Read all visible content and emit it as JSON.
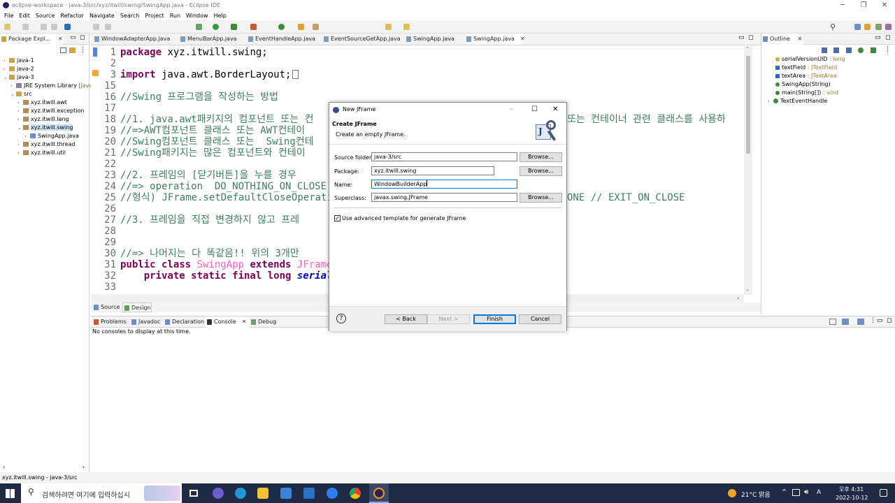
{
  "window": {
    "title": "eclipse-workspace - java-3/src/xyz/itwill/swing/SwingApp.java - Eclipse IDE"
  },
  "menu": [
    "File",
    "Edit",
    "Source",
    "Refactor",
    "Navigate",
    "Search",
    "Project",
    "Run",
    "Window",
    "Help"
  ],
  "package_explorer": {
    "title": "Package Expl...",
    "items": [
      {
        "label": "java-1",
        "level": 0
      },
      {
        "label": "java-2",
        "level": 0
      },
      {
        "label": "java-3",
        "level": 0
      },
      {
        "label": "JRE System Library",
        "suffix": "[JavaS",
        "level": 1
      },
      {
        "label": "src",
        "level": 1
      },
      {
        "label": "xyz.itwill.awt",
        "level": 2
      },
      {
        "label": "xyz.itwill.exception",
        "level": 2
      },
      {
        "label": "xyz.itwill.lang",
        "level": 2
      },
      {
        "label": "xyz.itwill.swing",
        "level": 2,
        "selected": true
      },
      {
        "label": "SwingApp.java",
        "level": 3
      },
      {
        "label": "xyz.itwill.thread",
        "level": 2
      },
      {
        "label": "xyz.itwill.util",
        "level": 2
      }
    ]
  },
  "editor": {
    "tabs": [
      "WindowAdapterApp.java",
      "MenuBarApp.java",
      "EventHandleApp.java",
      "EventSourceGetApp.java",
      "SwingApp.java",
      "SwingApp.java"
    ],
    "line_numbers": [
      "1",
      "2",
      "3",
      "15",
      "16",
      "17",
      "18",
      "19",
      "20",
      "21",
      "22",
      "23",
      "24",
      "25",
      "26",
      "27",
      "28",
      "29",
      "30",
      "31",
      "32",
      "33"
    ],
    "lines": {
      "l1_kw": "package",
      "l1_rest": " xyz.itwill.swing;",
      "l3_kw": "import",
      "l3_rest": " java.awt.BorderLayout;",
      "l16": "//Swing 프로그램을 작성하는 방법",
      "l18a": "//1. java.awt패키지의 컴포넌트 또는 컨",
      "l18b": "또는 컨테이너 관련 클래스를 사용하",
      "l19": "//=>AWT컴포넌트 클래스 또는 AWT컨테이",
      "l20": "//Swing컴포넌트 클래스 또는  Swing컨테",
      "l21": "//Swing패키지는 많은 컴포넌트와 컨테이",
      "l23": "//2. 프레임의 [닫기버튼]을 누를 경우 ",
      "l24": "//=> operation  DO_NOTHING_ON_CLOSE",
      "l25a": "//형식) JFrame.setDefaultCloseOperatio",
      "l25b": "ONE // EXIT_ON_CLOSE",
      "l27": "//3. 프레임을 직접 변경하지 않고 프레",
      "l30": "//=> 나머지는 다 똑같음!! 위의 3개만",
      "l31_kw": "public class",
      "l31_name": "SwingApp",
      "l31_kw2": "extends",
      "l31_super": "JFrame",
      "l31_brace": "{",
      "l32_kw": "private static final long",
      "l32_field": "serialV"
    },
    "bottom_tabs": [
      "Source",
      "Design"
    ]
  },
  "outline": {
    "title": "Outline",
    "items": [
      {
        "name": "serialVersionUID",
        "type": " : long"
      },
      {
        "name": "textField",
        "type": " : JTextField"
      },
      {
        "name": "textArea",
        "type": " : JTextArea"
      },
      {
        "name": "SwingApp(String)",
        "type": ""
      },
      {
        "name": "main(String[])",
        "type": " : void"
      },
      {
        "name": "TextEventHandle",
        "type": ""
      }
    ]
  },
  "console": {
    "tabs": [
      "Problems",
      "Javadoc",
      "Declaration",
      "Console",
      "Debug"
    ],
    "message": "No consoles to display at this time."
  },
  "dialog": {
    "title": "New JFrame",
    "header_title": "Create JFrame",
    "header_desc": "Create an empty JFrame.",
    "source_folder_label": "Source folder:",
    "source_folder_value": "java-3/src",
    "package_label": "Package:",
    "package_value": "xyz.itwill.swing",
    "name_label": "Name:",
    "name_value": "WindowBuilderApp",
    "superclass_label": "Superclass:",
    "superclass_value": "javax.swing.JFrame",
    "browse_label": "Browse...",
    "checkbox_label": "Use advanced template for generate JFrame",
    "checkbox_checked": true,
    "back_label": "< Back",
    "next_label": "Next >",
    "finish_label": "Finish",
    "cancel_label": "Cancel"
  },
  "status_bar": {
    "text": "xyz.itwill.swing - java-3/src"
  },
  "taskbar": {
    "search_placeholder": "검색하려면 여기에 입력하십시",
    "weather": "21°C 맑음",
    "time": "오후 4:31",
    "date": "2022-10-12"
  },
  "colors": {
    "comment": "#3f7f5f",
    "keyword": "#7f0055",
    "class_highlight": "#ff5dc0",
    "field": "#0000c0",
    "taskbar": "#1f2a44"
  }
}
